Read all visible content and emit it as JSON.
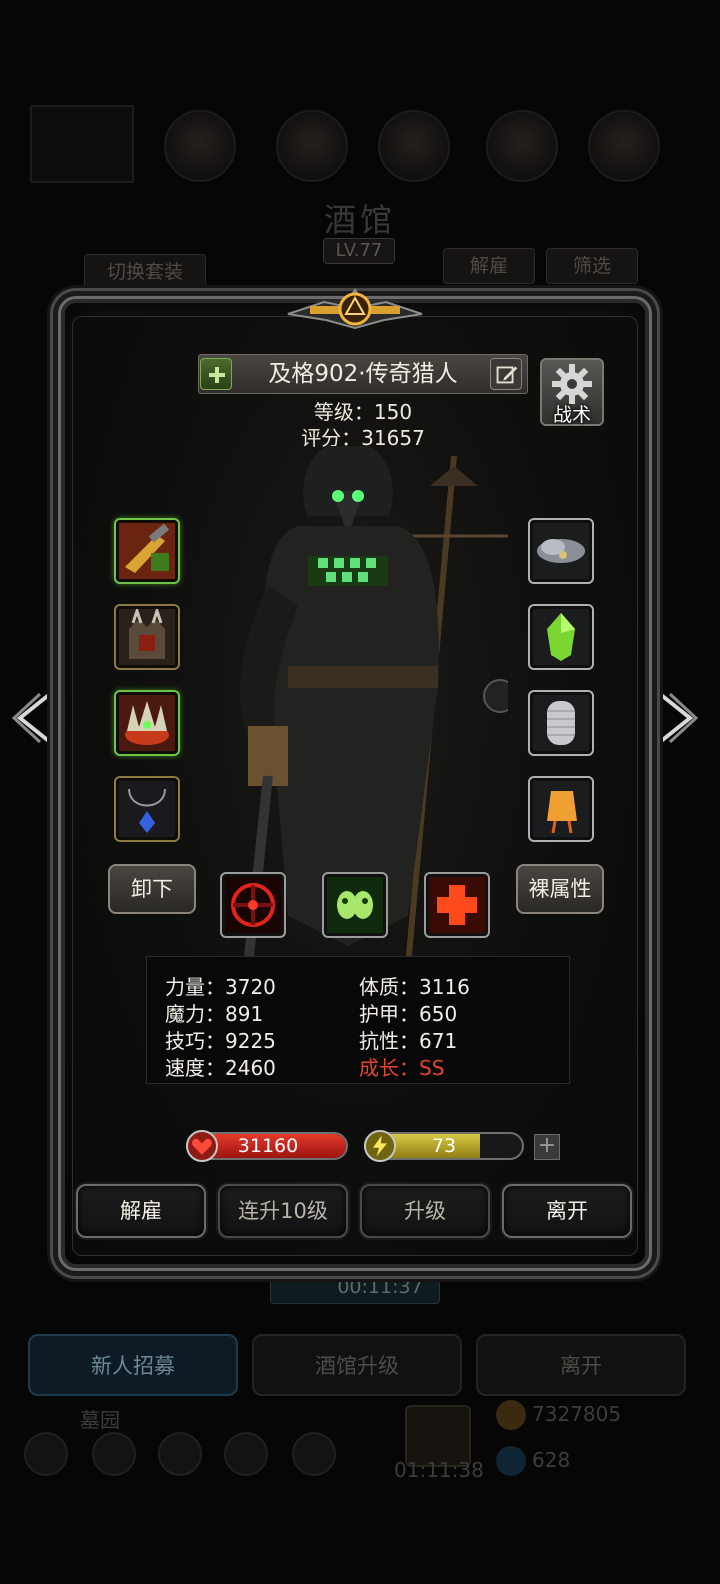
{
  "background": {
    "title": "酒馆",
    "level": "LV.77",
    "switch_outfit": "切换套装",
    "dismiss": "解雇",
    "filter": "筛选",
    "timer": "00:11:37",
    "tabs": [
      "新人招募",
      "酒馆升级",
      "离开"
    ],
    "garden": "墓园",
    "gift_timer": "01:11:38",
    "gold": "7327805",
    "gems": "628"
  },
  "hero": {
    "name": "及格902·传奇猎人",
    "level_text": "等级：150",
    "score_text": "评分：31657",
    "tactics_label": "战术"
  },
  "equipment": {
    "left": [
      "golden-shotgun-icon",
      "spiked-armor-icon",
      "thorn-crown-icon",
      "blue-pendant-icon"
    ],
    "right": [
      "storm-cloud-icon",
      "green-gem-icon",
      "chainmail-glove-icon",
      "lantern-icon"
    ]
  },
  "actions": {
    "unequip": "卸下",
    "base_attributes": "裸属性"
  },
  "skills": [
    "red-target-skill-icon",
    "green-skulls-skill-icon",
    "red-cross-skill-icon"
  ],
  "stats": {
    "strength": "力量：3720",
    "constitution": "体质：3116",
    "magic": "魔力：891",
    "armor": "护甲：650",
    "skill": "技巧：9225",
    "resistance": "抗性：671",
    "speed": "速度：2460",
    "growth": "成长：SS"
  },
  "vitals": {
    "hp": "31160",
    "hp_fraction": 1.0,
    "energy": "73",
    "energy_fraction": 0.73,
    "energy_plus": "+"
  },
  "buttons": {
    "dismiss": "解雇",
    "level_up_10": "连升10级",
    "level_up": "升级",
    "leave": "离开"
  },
  "colors": {
    "growth_red": "#e2462a",
    "hp_red": "#e43a2c",
    "energy_yellow": "#d8c845"
  }
}
